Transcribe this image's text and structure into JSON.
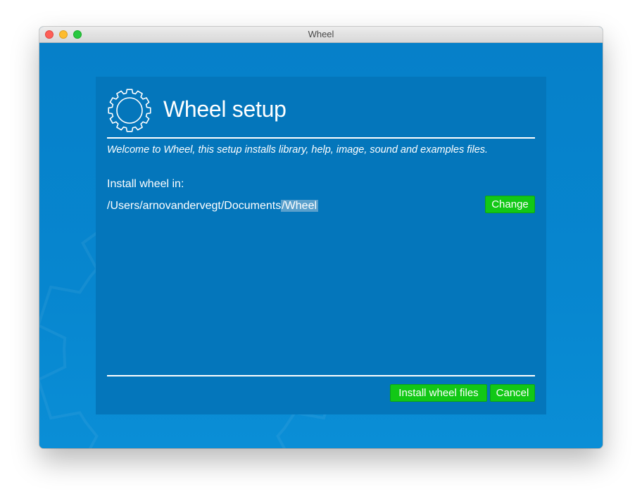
{
  "window": {
    "title": "Wheel"
  },
  "setup": {
    "title": "Wheel setup",
    "welcome": "Welcome to Wheel, this setup installs library, help, image, sound and examples files.",
    "install_label": "Install wheel in:",
    "path_prefix": "/Users/arnovandervegt/Documents",
    "path_selected": "/Wheel"
  },
  "buttons": {
    "change": "Change",
    "install": "Install wheel files",
    "cancel": "Cancel"
  },
  "icons": {
    "header": "gear-icon",
    "background": "gear-watermark"
  },
  "colors": {
    "background": "#0a83cc",
    "panel": "#0476bb",
    "button": "#12c816",
    "path_highlight": "#5aa0cc"
  }
}
